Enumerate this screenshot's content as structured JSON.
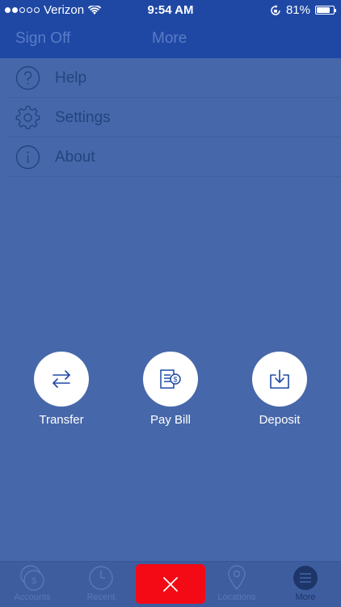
{
  "status_bar": {
    "carrier": "Verizon",
    "time": "9:54 AM",
    "battery_percent": "81%",
    "battery_level": 0.81,
    "signal_bars_filled": 2,
    "signal_bars_total": 5
  },
  "nav": {
    "sign_off_label": "Sign Off",
    "title": "More"
  },
  "menu": {
    "items": [
      {
        "label": "Help",
        "icon": "question-circle-icon"
      },
      {
        "label": "Settings",
        "icon": "gear-icon"
      },
      {
        "label": "About",
        "icon": "info-circle-icon"
      }
    ]
  },
  "actions": {
    "transfer_label": "Transfer",
    "pay_bill_label": "Pay Bill",
    "deposit_label": "Deposit"
  },
  "tabbar": {
    "accounts_label": "Accounts",
    "recent_label": "Recent",
    "locations_label": "Locations",
    "more_label": "More",
    "active_tab": "More"
  },
  "colors": {
    "header": "#1f48a5",
    "overlay_background": "#4667a9",
    "close_button": "#f30a14",
    "action_circle": "#ffffff"
  }
}
